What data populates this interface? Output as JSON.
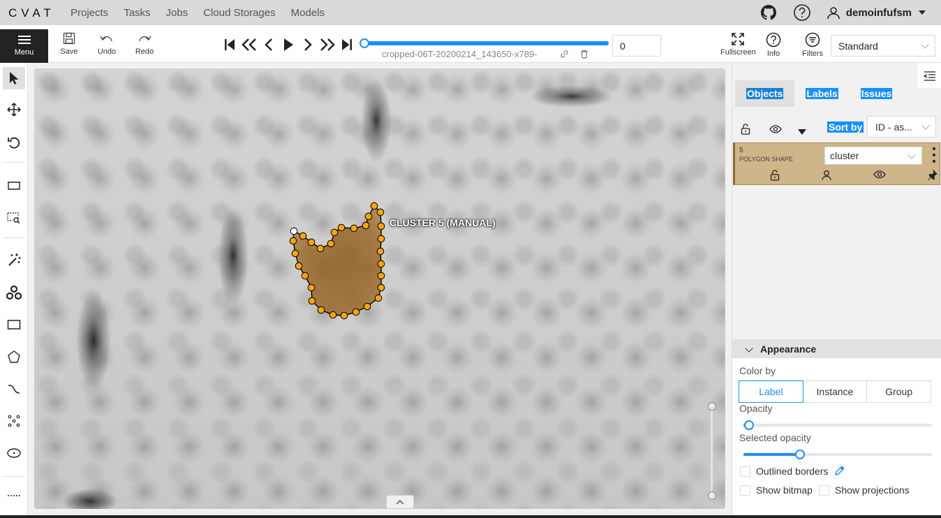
{
  "header": {
    "logo": "CVAT",
    "nav": [
      "Projects",
      "Tasks",
      "Jobs",
      "Cloud Storages",
      "Models"
    ],
    "username": "demoinfufsm"
  },
  "toolbar": {
    "menu_label": "Menu",
    "save_label": "Save",
    "undo_label": "Undo",
    "redo_label": "Redo",
    "filename": "cropped-06T-20200214_143650-x789-",
    "frame_number": "0",
    "frame_progress": 0.0,
    "fullscreen_label": "Fullscreen",
    "info_label": "Info",
    "filters_label": "Filters",
    "workspace": "Standard"
  },
  "canvas": {
    "shape_label": "CLUSTER 5 (MANUAL)",
    "shape_color": "#ffa500"
  },
  "sidebar": {
    "tabs": [
      "Objects",
      "Labels",
      "Issues"
    ],
    "sort_by_label": "Sort by",
    "sort_value": "ID - as...",
    "object": {
      "id": "5",
      "type": "POLYGON SHAPE",
      "label": "cluster"
    },
    "appearance": {
      "title": "Appearance",
      "color_by_label": "Color by",
      "color_by_options": [
        "Label",
        "Instance",
        "Group"
      ],
      "color_by_selected": "Label",
      "opacity_label": "Opacity",
      "opacity_value": 0.03,
      "selected_opacity_label": "Selected opacity",
      "selected_opacity_value": 0.3,
      "outlined_borders_label": "Outlined borders",
      "show_bitmap_label": "Show bitmap",
      "show_projections_label": "Show projections"
    }
  }
}
